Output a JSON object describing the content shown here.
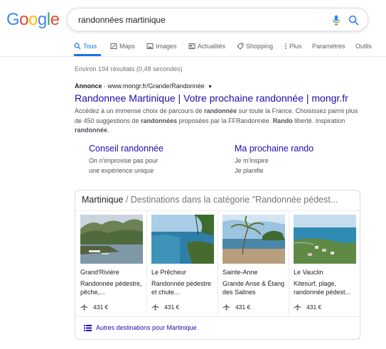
{
  "logo": {
    "letters": [
      "G",
      "o",
      "o",
      "g",
      "l",
      "e"
    ],
    "colors": [
      "#4285f4",
      "#ea4335",
      "#fbbc05",
      "#4285f4",
      "#34a853",
      "#ea4335"
    ]
  },
  "search": {
    "query": "randonnées martinique"
  },
  "tabs": [
    {
      "label": "Tous",
      "icon": "search-icon",
      "active": true
    },
    {
      "label": "Maps",
      "icon": "map-icon"
    },
    {
      "label": "Images",
      "icon": "image-icon"
    },
    {
      "label": "Actualités",
      "icon": "news-icon"
    },
    {
      "label": "Shopping",
      "icon": "tag-icon"
    },
    {
      "label": "Plus",
      "icon": "more-vert-icon"
    },
    {
      "label": "Paramètres"
    },
    {
      "label": "Outils"
    }
  ],
  "stats": "Environ 194 résultats (0,48 secondes)",
  "ad": {
    "badge": "Annonce",
    "url": "www.mongr.fr/Grande/Randonnée",
    "title": "Randonnee Martinique | Votre prochaine randonnée | mongr.fr",
    "desc": {
      "p1": "Accédez à un immense choix de parcours de ",
      "b1": "randonnée",
      "p2": " sur toute la France. Choisissez parmi plus de 450 suggestions de ",
      "b2": "randonnées",
      "p3": " proposées par la FFRandonnée. ",
      "b3": "Rando",
      "p4": " liberté. Inspiration ",
      "b4": "randonnée",
      "p5": "."
    },
    "sitelinks": [
      {
        "title": "Conseil randonnée",
        "line1": "On n'improvise pas pour",
        "line2": "une expérience unique"
      },
      {
        "title": "Ma prochaine rando",
        "line1": "Je m'inspire",
        "line2": "Je planifie"
      }
    ]
  },
  "destinations": {
    "heading": "Martinique",
    "subheading": " / Destinations dans la catégorie \"Randonnée pédest...",
    "items": [
      {
        "name": "Grand'Rivière",
        "desc": "Randonnée pédestre, pêche,...",
        "price": "431 €"
      },
      {
        "name": "Le Prêcheur",
        "desc": "Randonnée pédestre et chute...",
        "price": "431 €"
      },
      {
        "name": "Sainte-Anne",
        "desc": "Grande Anse & Étang des Salines",
        "price": "431 €"
      },
      {
        "name": "Le Vauclin",
        "desc": "Kitesurf, plage, randonnée pédest...",
        "price": "431 €"
      }
    ],
    "more_link": "Autres destinations pour Martinique"
  }
}
